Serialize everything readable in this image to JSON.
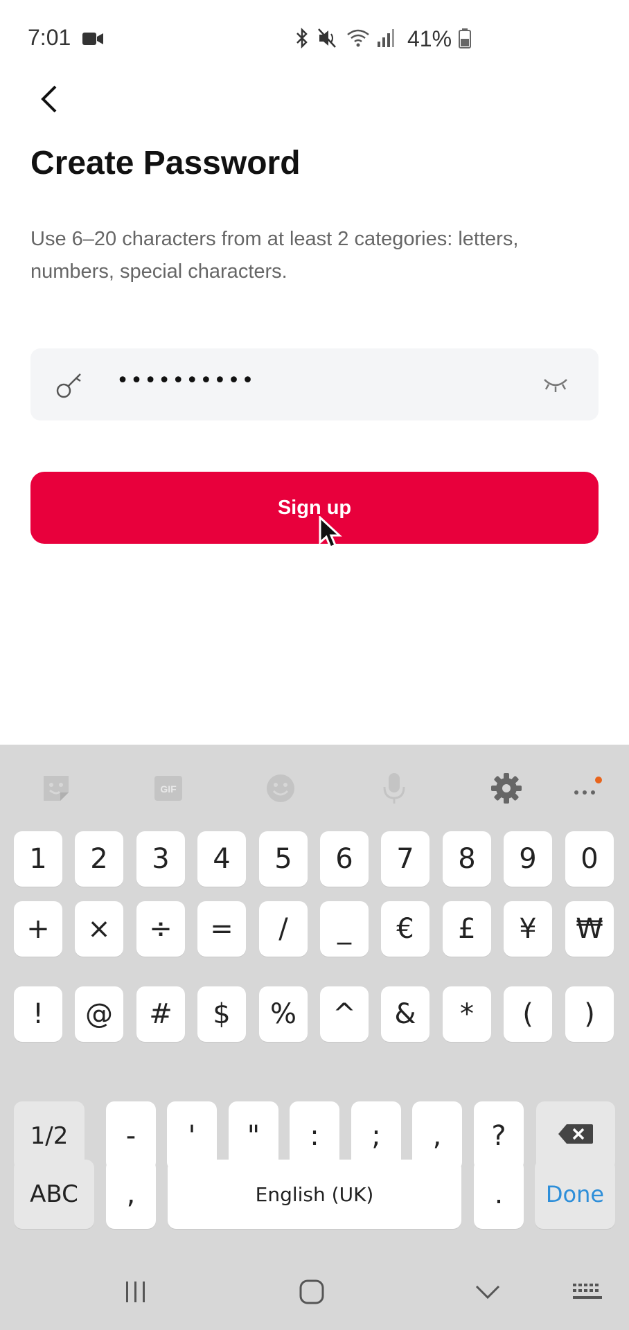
{
  "status": {
    "time": "7:01",
    "battery_pct": "41%",
    "icons": [
      "video-icon",
      "bluetooth-icon",
      "mute-icon",
      "wifi-icon",
      "signal-icon",
      "battery-icon"
    ]
  },
  "header": {
    "title": "Create Password",
    "subtitle": "Use 6–20 characters from at least 2 categories: letters, numbers, special characters."
  },
  "password": {
    "masked_value": "••••••••••"
  },
  "signup": {
    "label": "Sign up"
  },
  "colors": {
    "accent": "#e8003c",
    "keyboard_bg": "#d7d7d7",
    "done": "#2d8ed9"
  },
  "keyboard": {
    "toolbar": [
      "sticker-icon",
      "gif-icon",
      "emoji-icon",
      "mic-icon",
      "settings-gear-icon",
      "more-dots-icon"
    ],
    "row1": [
      "1",
      "2",
      "3",
      "4",
      "5",
      "6",
      "7",
      "8",
      "9",
      "0"
    ],
    "row2": [
      "+",
      "×",
      "÷",
      "=",
      "/",
      "_",
      "€",
      "£",
      "¥",
      "₩"
    ],
    "row3": [
      "!",
      "@",
      "#",
      "$",
      "%",
      "^",
      "&",
      "*",
      "(",
      ")"
    ],
    "row4": {
      "shift": "1/2",
      "keys": [
        "-",
        "'",
        "\"",
        ":",
        ";",
        ",",
        "?"
      ]
    },
    "row5": {
      "abc": "ABC",
      "comma": ",",
      "space": "English (UK)",
      "period": ".",
      "done": "Done"
    }
  },
  "nav": [
    "recents-icon",
    "home-icon",
    "back-chevron-icon",
    "keyboard-icon"
  ]
}
